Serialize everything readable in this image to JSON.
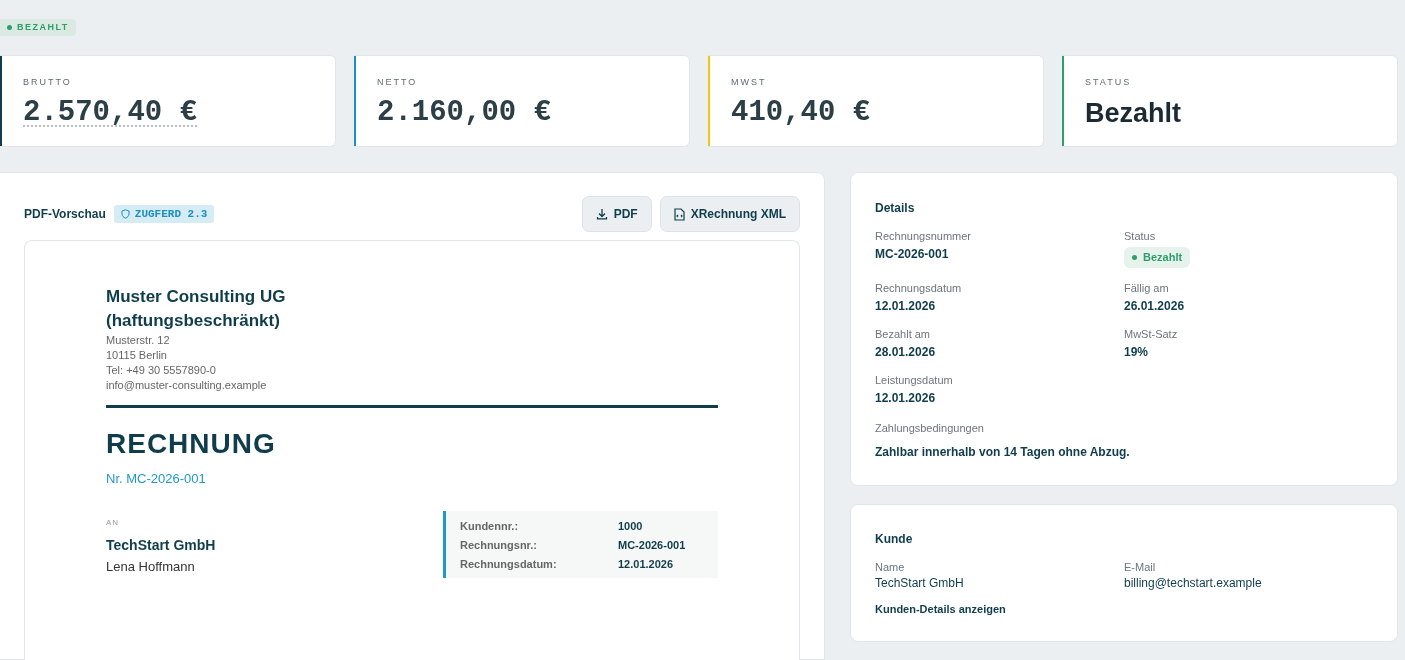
{
  "status_badge": {
    "label": "BEZAHLT",
    "color": "#2e9e6a"
  },
  "stats": [
    {
      "label": "BRUTTO",
      "value": "2.570,40 €",
      "kind": "money",
      "color": "#0f3d4c",
      "dotted_underline": true
    },
    {
      "label": "NETTO",
      "value": "2.160,00 €",
      "kind": "money",
      "color": "#1f8fbf",
      "dotted_underline": false
    },
    {
      "label": "MWST",
      "value": "410,40 €",
      "kind": "money",
      "color": "#f2c511",
      "dotted_underline": false
    },
    {
      "label": "STATUS",
      "value": "Bezahlt",
      "kind": "text",
      "color": "#2e9e6a",
      "dotted_underline": false
    }
  ],
  "preview": {
    "title": "PDF-Vorschau",
    "format_badge": "ZUGFERD 2.3",
    "buttons": [
      {
        "label": "PDF"
      },
      {
        "label": "XRechnung XML"
      }
    ],
    "document": {
      "company": "Muster Consulting UG (haftungsbeschränkt)",
      "address_lines": [
        "Musterstr. 12",
        "10115 Berlin",
        "Tel: +49 30 5557890-0",
        "info@muster-consulting.example"
      ],
      "heading": "RECHNUNG",
      "number": "Nr. MC-2026-001",
      "recipient_label": "AN",
      "recipient_name": "TechStart GmbH",
      "recipient_lines": [
        "Lena Hoffmann"
      ],
      "meta": [
        {
          "label": "Kundennr.:",
          "value": "1000"
        },
        {
          "label": "Rechnungsnr.:",
          "value": "MC-2026-001"
        },
        {
          "label": "Rechnungsdatum:",
          "value": "12.01.2026"
        }
      ]
    }
  },
  "details": {
    "title": "Details",
    "fields": [
      {
        "label": "Rechnungsnummer",
        "value": "MC-2026-001",
        "kind": "text"
      },
      {
        "label": "Status",
        "value": "Bezahlt",
        "kind": "badge",
        "color": "#2e9e6a"
      },
      {
        "label": "Rechnungsdatum",
        "value": "12.01.2026",
        "kind": "text"
      },
      {
        "label": "Fällig am",
        "value": "26.01.2026",
        "kind": "text"
      },
      {
        "label": "Bezahlt am",
        "value": "28.01.2026",
        "kind": "text"
      },
      {
        "label": "MwSt-Satz",
        "value": "19%",
        "kind": "text"
      },
      {
        "label": "Leistungsdatum",
        "value": "12.01.2026",
        "kind": "text"
      }
    ],
    "terms_label": "Zahlungsbedingungen",
    "terms": "Zahlbar innerhalb von 14 Tagen ohne Abzug."
  },
  "customer": {
    "title": "Kunde",
    "fields": [
      {
        "label": "Name",
        "value": "TechStart GmbH"
      },
      {
        "label": "E-Mail",
        "value": "billing@techstart.example"
      }
    ],
    "link": "Kunden-Details anzeigen"
  }
}
